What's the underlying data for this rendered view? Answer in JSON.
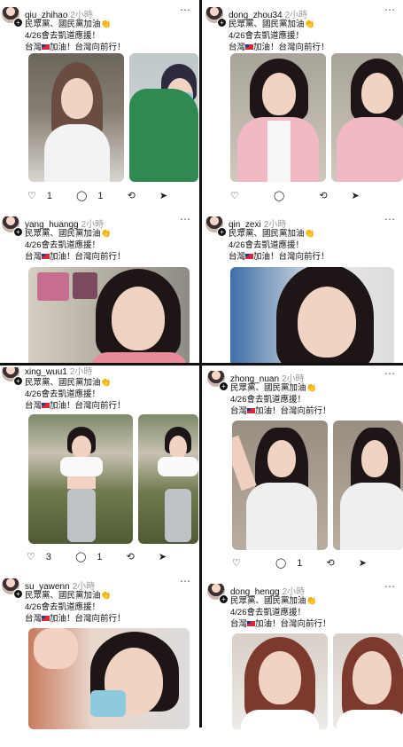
{
  "posts": [
    {
      "user": "qiu_zhihao",
      "time": "2小時"
    },
    {
      "user": "dong_zhou34",
      "time": "2小時"
    },
    {
      "user": "yang_huangg",
      "time": "2小時"
    },
    {
      "user": "qin_zexi",
      "time": "2小時"
    },
    {
      "user": "xing_wuu1",
      "time": "2小時"
    },
    {
      "user": "zhong_nuan",
      "time": "2小時"
    },
    {
      "user": "su_yawenn",
      "time": "2小時"
    },
    {
      "user": "dong_hengg",
      "time": "2小時"
    }
  ],
  "text": {
    "line1": "民眾黨、國民黨加油👏",
    "line2": "4/26會去凱道應援！",
    "line3a": "台灣",
    "line3b": "加油！台灣向前行！"
  },
  "icons": {
    "more": "⋯",
    "like": "♡",
    "reply": "◯",
    "repost": "⟲",
    "share": "➤"
  },
  "counts": {
    "post1_likes": "1",
    "post1_replies": "1",
    "post2_likes": "",
    "post2_replies": "",
    "post5_likes": "3",
    "post5_replies": "1",
    "post6_likes": "",
    "post6_replies": "1"
  },
  "colors": {
    "flag_red": "#d9263b",
    "flag_blue": "#1f3a93",
    "time_gray": "#9a9a9a"
  }
}
